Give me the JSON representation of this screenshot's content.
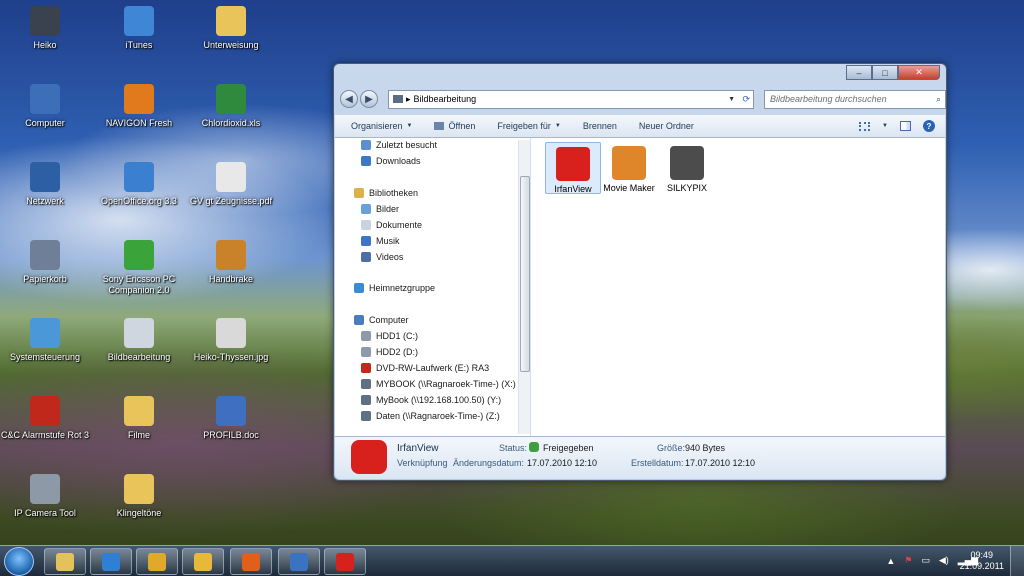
{
  "desktop": {
    "icons": [
      {
        "label": "Heiko",
        "icon": "user-folder-icon",
        "color": "#3a4250"
      },
      {
        "label": "iTunes",
        "icon": "itunes-icon",
        "color": "#3f86d6"
      },
      {
        "label": "Unterweisung",
        "icon": "folder-icon",
        "color": "#e8c45a"
      },
      {
        "label": "Computer",
        "icon": "computer-icon",
        "color": "#3c6fb8"
      },
      {
        "label": "NAVIGON Fresh",
        "icon": "navigon-icon",
        "color": "#e07a1c"
      },
      {
        "label": "Chlordioxid.xls",
        "icon": "excel-file-icon",
        "color": "#2f8a3e"
      },
      {
        "label": "Netzwerk",
        "icon": "network-icon",
        "color": "#2d5fa5"
      },
      {
        "label": "OpenOffice.org 3.3",
        "icon": "openoffice-icon",
        "color": "#3b7fd0"
      },
      {
        "label": "GV gt Zeugnisse.pdf",
        "icon": "pdf-file-icon",
        "color": "#e8e8e8"
      },
      {
        "label": "Papierkorb",
        "icon": "recycle-bin-icon",
        "color": "#6f7f97"
      },
      {
        "label": "Sony Ericsson PC Companion 2.0",
        "icon": "sony-ericsson-icon",
        "color": "#3aa33a"
      },
      {
        "label": "Handbrake",
        "icon": "handbrake-icon",
        "color": "#c9822a"
      },
      {
        "label": "Systemsteuerung",
        "icon": "control-panel-icon",
        "color": "#4a98d8"
      },
      {
        "label": "Bildbearbeitung",
        "icon": "camera-folder-icon",
        "color": "#cfd6df"
      },
      {
        "label": "Heiko-Thyssen.jpg",
        "icon": "image-file-icon",
        "color": "#d9d9d9"
      },
      {
        "label": "C&C Alarmstufe Rot 3",
        "icon": "cnc-red-alert-icon",
        "color": "#c0281c"
      },
      {
        "label": "Filme",
        "icon": "folder-icon",
        "color": "#e8c45a"
      },
      {
        "label": "PROFILB.doc",
        "icon": "word-file-icon",
        "color": "#3e6fc1"
      },
      {
        "label": "IP Camera Tool",
        "icon": "ip-camera-icon",
        "color": "#8e99a8"
      },
      {
        "label": "Klingeltöne",
        "icon": "folder-icon",
        "color": "#e8c45a"
      }
    ]
  },
  "window": {
    "controls": {
      "minimize": "‒",
      "maximize": "□",
      "close": "✕"
    },
    "nav_back": "◀",
    "nav_forward": "▶",
    "address_path": "Bildbearbeitung",
    "address_prefix": "▸",
    "search_placeholder": "Bildbearbeitung durchsuchen",
    "toolbar": {
      "organize": "Organisieren",
      "open": "Öffnen",
      "share": "Freigeben für",
      "burn": "Brennen",
      "new_folder": "Neuer Ordner"
    },
    "nav_pane": {
      "items": [
        {
          "label": "Zuletzt besucht",
          "icon": "recent-places-icon",
          "color": "#5b8fcf"
        },
        {
          "label": "Downloads",
          "icon": "downloads-icon",
          "color": "#3d78c4"
        },
        {
          "label": "Bibliotheken",
          "icon": "libraries-icon",
          "color": "#d9b24d"
        },
        {
          "label": "Bilder",
          "icon": "pictures-icon",
          "color": "#6aa0d8"
        },
        {
          "label": "Dokumente",
          "icon": "documents-icon",
          "color": "#c9d3df"
        },
        {
          "label": "Musik",
          "icon": "music-icon",
          "color": "#3c75c7"
        },
        {
          "label": "Videos",
          "icon": "videos-icon",
          "color": "#4c6fa6"
        },
        {
          "label": "Heimnetzgruppe",
          "icon": "homegroup-icon",
          "color": "#3b8bd3"
        },
        {
          "label": "Computer",
          "icon": "computer-icon",
          "color": "#4a7bbf"
        },
        {
          "label": "HDD1 (C:)",
          "icon": "drive-icon",
          "color": "#8e9aab"
        },
        {
          "label": "HDD2 (D:)",
          "icon": "drive-icon",
          "color": "#8e9aab"
        },
        {
          "label": "DVD-RW-Laufwerk (E:) RA3",
          "icon": "dvd-drive-icon",
          "color": "#c0281c"
        },
        {
          "label": "MYBOOK (\\\\Ragnaroek-Time-) (X:)",
          "icon": "network-drive-icon",
          "color": "#5f6f86"
        },
        {
          "label": "MyBook (\\\\192.168.100.50) (Y:)",
          "icon": "network-drive-icon",
          "color": "#5f6f86"
        },
        {
          "label": "Daten (\\\\Ragnaroek-Time-) (Z:)",
          "icon": "network-drive-icon",
          "color": "#5f6f86"
        }
      ]
    },
    "files": [
      {
        "label": "IrfanView",
        "icon": "irfanview-icon",
        "color": "#d8201d",
        "selected": true
      },
      {
        "label": "Movie Maker",
        "icon": "movie-maker-icon",
        "color": "#e0862a",
        "selected": false
      },
      {
        "label": "SILKYPIX",
        "icon": "silkypix-icon",
        "color": "#4c4c4c",
        "selected": false
      }
    ],
    "details": {
      "name": "IrfanView",
      "type": "Verknüpfung",
      "status_label": "Status:",
      "status_value": "Freigegeben",
      "modified_label": "Änderungsdatum:",
      "modified_value": "17.07.2010 12:10",
      "size_label": "Größe:",
      "size_value": "940 Bytes",
      "created_label": "Erstelldatum:",
      "created_value": "17.07.2010 12:10"
    }
  },
  "taskbar": {
    "pinned": [
      {
        "name": "explorer",
        "icon": "explorer-icon",
        "color": "#e3c25a"
      },
      {
        "name": "media player",
        "icon": "media-player-icon",
        "color": "#2f7fd4"
      },
      {
        "name": "tool",
        "icon": "tool-icon",
        "color": "#e0a92c"
      },
      {
        "name": "mail",
        "icon": "mail-icon",
        "color": "#e8b83a"
      },
      {
        "name": "firefox",
        "icon": "firefox-icon",
        "color": "#e05f1d"
      },
      {
        "name": "remote desktop",
        "icon": "remote-desktop-icon",
        "color": "#3a73c2"
      },
      {
        "name": "irfanview",
        "icon": "irfanview-icon",
        "color": "#d8201d"
      }
    ],
    "clock_time": "09:49",
    "clock_date": "21.09.2011"
  }
}
